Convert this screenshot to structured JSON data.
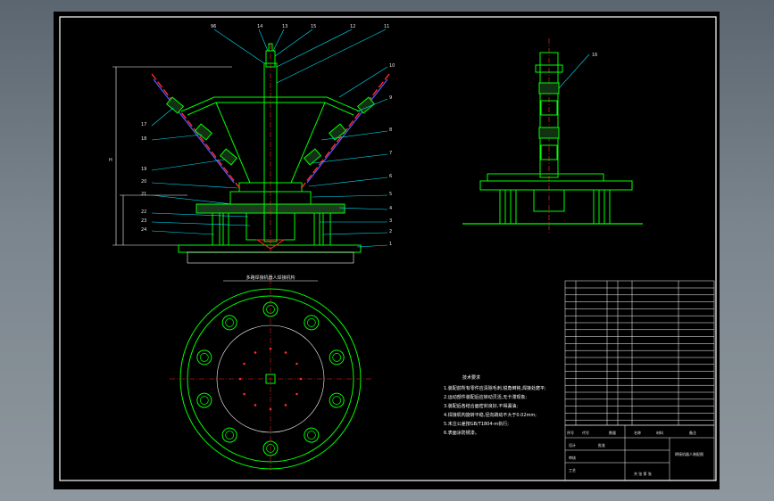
{
  "drawing": {
    "front_callouts_top": [
      "96",
      "14",
      "13",
      "15",
      "12",
      "11"
    ],
    "front_callouts_right": [
      "10",
      "9",
      "8",
      "7",
      "6",
      "5",
      "4",
      "3",
      "2",
      "1"
    ],
    "front_callouts_left": [
      "17",
      "18",
      "19",
      "20",
      "21",
      "22",
      "23",
      "24"
    ],
    "side_callout": "16",
    "plan_title": "多路焊接机器人焊接机构",
    "dim_label": "H"
  },
  "notes": {
    "heading": "技术要求",
    "lines": [
      "1.装配前所有零件应清除毛刺,锐角倒钝,焊接处磨平;",
      "2.运动部件装配后应转动灵活,无卡滞现象;",
      "3.装配后各结合面密封良好,不得漏油;",
      "4.焊接机构旋转平稳,径向跳动不大于0.02mm;",
      "5.未注公差按GB/T1804-m执行;",
      "6.表面涂防锈漆。"
    ]
  },
  "title_block": {
    "drawing_name": "焊接机器人装配图",
    "scale_label": "共 张 第 张",
    "sign_rows": [
      "设计",
      "审核",
      "工艺",
      "批准"
    ],
    "header_cells": [
      "序号",
      "代号",
      "名称",
      "数量",
      "材料",
      "备注"
    ]
  },
  "colors": {
    "structure": "#00ff00",
    "pipe": "#ff2a2a",
    "link": "#5a5aff",
    "callout": "#00e5ff",
    "text": "#ffffff",
    "frame": "#ffffff"
  }
}
